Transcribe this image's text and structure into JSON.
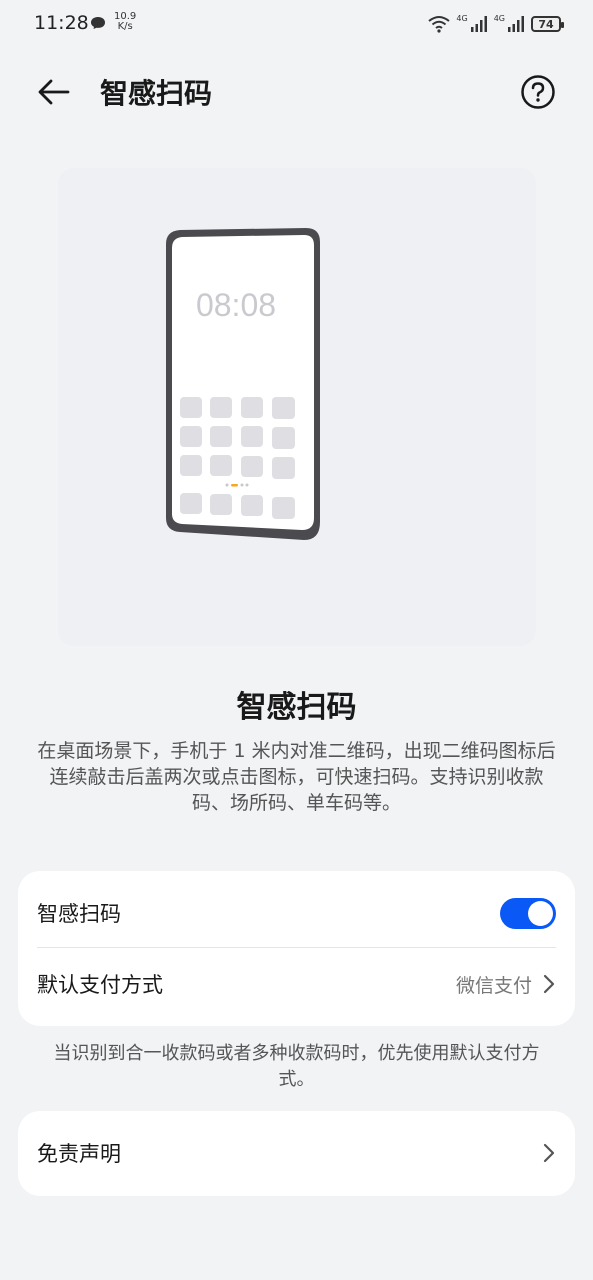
{
  "status_bar": {
    "time": "11:28",
    "speed_value": "10.9",
    "speed_unit": "K/s",
    "net1": "4G",
    "net2": "4G",
    "battery": "74"
  },
  "header": {
    "title": "智感扫码"
  },
  "illustration": {
    "clock": "08:08"
  },
  "feature": {
    "title": "智感扫码",
    "description": "在桌面场景下，手机于 1 米内对准二维码，出现二维码图标后连续敲击后盖两次或点击图标，可快速扫码。支持识别收款码、场所码、单车码等。"
  },
  "settings": {
    "toggle_label": "智感扫码",
    "toggle_on": true,
    "payment_label": "默认支付方式",
    "payment_value": "微信支付"
  },
  "note": "当识别到合一收款码或者多种收款码时，优先使用默认支付方式。",
  "disclaimer": {
    "label": "免责声明"
  },
  "colors": {
    "accent": "#0a59f7",
    "background": "#f1f3f5"
  }
}
